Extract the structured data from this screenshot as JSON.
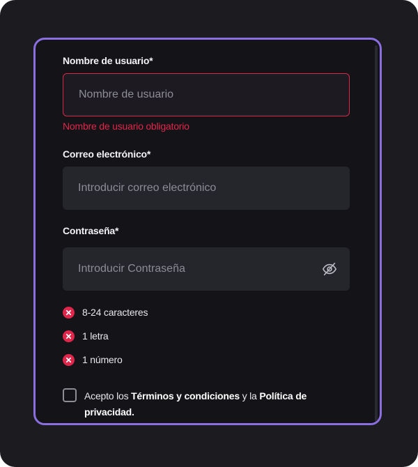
{
  "form": {
    "username": {
      "label": "Nombre de usuario*",
      "placeholder": "Nombre de usuario",
      "value": "",
      "error": "Nombre de usuario obligatorio"
    },
    "email": {
      "label": "Correo electrónico*",
      "placeholder": "Introducir correo electrónico",
      "value": ""
    },
    "password": {
      "label": "Contraseña*",
      "placeholder": "Introducir Contraseña",
      "value": "",
      "toggle_icon": "eye-off-icon"
    },
    "requirements": [
      {
        "text": "8-24 caracteres",
        "met": false
      },
      {
        "text": "1 letra",
        "met": false
      },
      {
        "text": "1 número",
        "met": false
      }
    ],
    "terms": {
      "checked": false,
      "prefix": "Acepto los ",
      "terms_link": "Términos y condiciones",
      "middle": " y la ",
      "privacy_link": "Política de privacidad",
      "suffix": "."
    }
  },
  "colors": {
    "accent_border": "#8a6fe0",
    "error": "#e0264a",
    "background": "#1b1b20",
    "input_background": "#25252c"
  }
}
